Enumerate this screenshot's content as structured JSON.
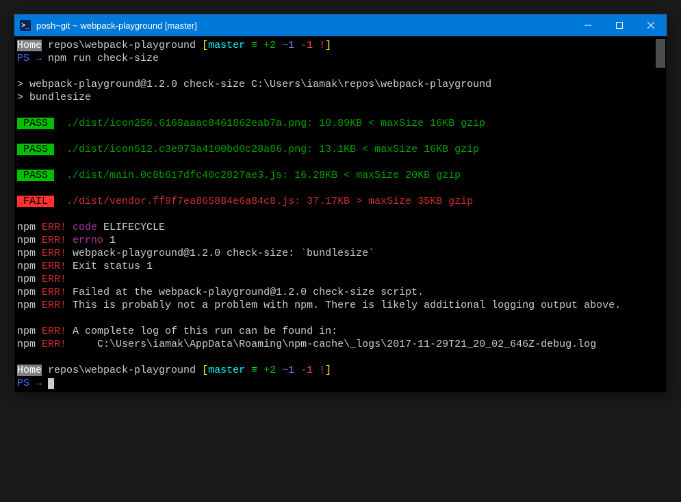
{
  "titlebar": {
    "title": "posh~git ~ webpack-playground [master]"
  },
  "prompt1": {
    "home": "Home",
    "path": " repos\\webpack-playground ",
    "lb": "[",
    "branch": "master",
    "sym": " ≡ ",
    "plus": "+2",
    "tilde": " ~1",
    "minus": " -1",
    "bang": " !",
    "rb": "]"
  },
  "ps_line": {
    "ps": "PS",
    "arrow": " → ",
    "cmd": "npm run check-size"
  },
  "run_header": {
    "l1": "> webpack-playground@1.2.0 check-size C:\\Users\\iamak\\repos\\webpack-playground",
    "l2": "> bundlesize"
  },
  "results": {
    "pass_label": " PASS ",
    "fail_label": " FAIL ",
    "r1": "  ./dist/icon256.6168aaac8461862eab7a.png: 10.89KB < maxSize 16KB gzip",
    "r2": "  ./dist/icon512.c3e073a4100bd0c28a86.png: 13.1KB < maxSize 16KB gzip",
    "r3": "  ./dist/main.0c8b617dfc40c2827ae3.js: 16.28KB < maxSize 20KB gzip",
    "r4": "  ./dist/vendor.ff9f7ea865884e6a84c8.js: 37.17KB > maxSize 35KB gzip"
  },
  "errors": {
    "npm": "npm",
    "err": " ERR!",
    "code_label": " code",
    "code_val": " ELIFECYCLE",
    "errno_label": " errno",
    "errno_val": " 1",
    "e3": " webpack-playground@1.2.0 check-size: `bundlesize`",
    "e4": " Exit status 1",
    "e6": " Failed at the webpack-playground@1.2.0 check-size script.",
    "e7": " This is probably not a problem with npm. There is likely additional logging output above.",
    "e8": " A complete log of this run can be found in:",
    "e9": "     C:\\Users\\iamak\\AppData\\Roaming\\npm-cache\\_logs\\2017-11-29T21_20_02_646Z-debug.log"
  },
  "prompt2": {
    "ps": "PS",
    "arrow": " → "
  }
}
